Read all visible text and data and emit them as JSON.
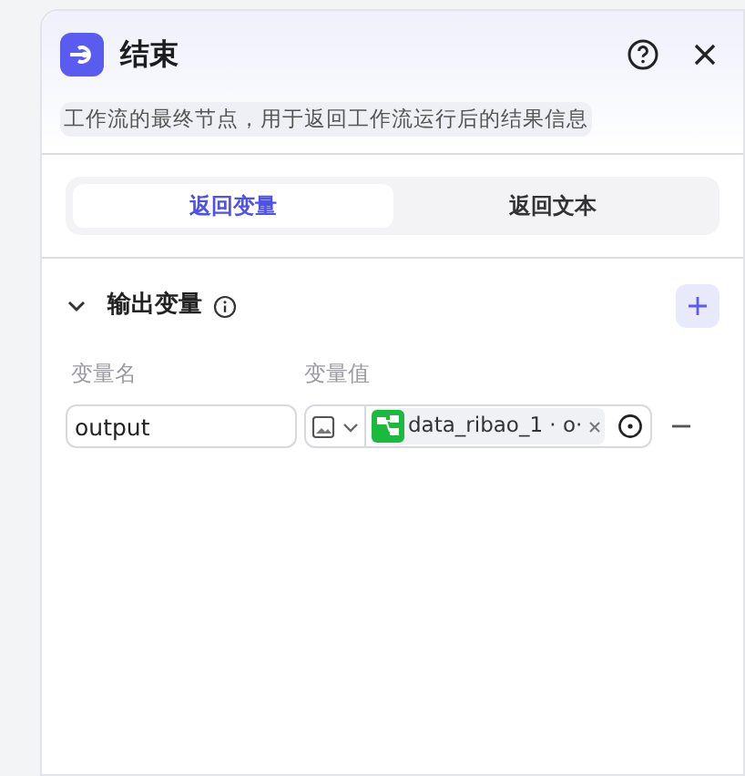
{
  "header": {
    "title": "结束",
    "description": "工作流的最终节点，用于返回工作流运行后的结果信息"
  },
  "tabs": [
    {
      "label": "返回变量",
      "selected": true
    },
    {
      "label": "返回文本",
      "selected": false
    }
  ],
  "output_section": {
    "title": "输出变量",
    "expanded": true,
    "columns": [
      "变量名",
      "变量值"
    ],
    "rows": [
      {
        "name": "output",
        "reference": "data_ribao_1 · o·"
      }
    ]
  }
}
